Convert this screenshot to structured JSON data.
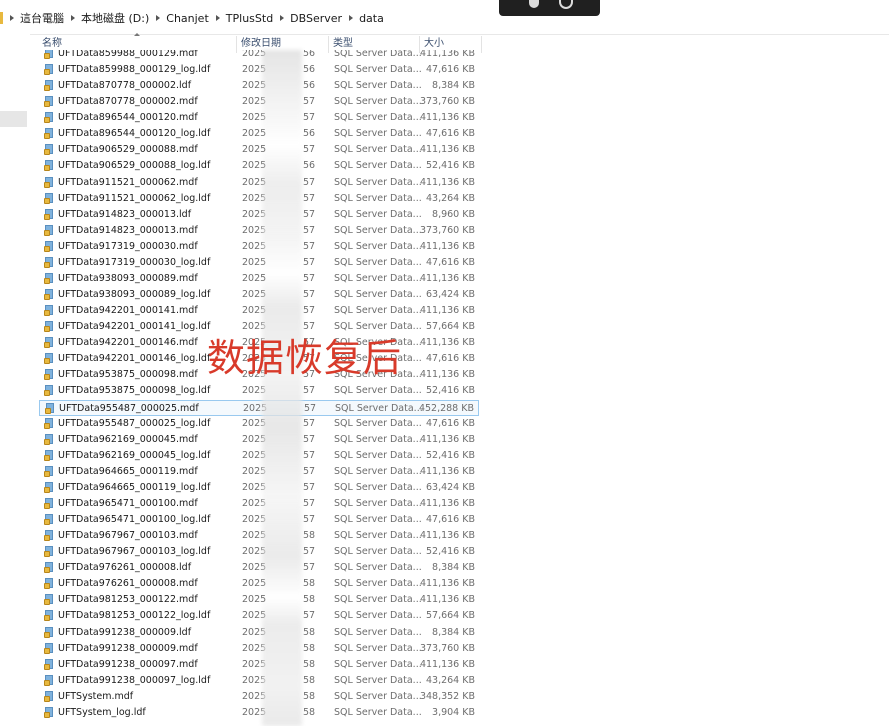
{
  "breadcrumb": [
    "這台電腦",
    "本地磁盘 (D:)",
    "Chanjet",
    "TPlusStd",
    "DBServer",
    "data"
  ],
  "columns": {
    "name": "名称",
    "date": "修改日期",
    "type": "类型",
    "size": "大小"
  },
  "watermark": "数据恢复后",
  "files": [
    {
      "name": "UFTData859988_000129.mdf",
      "date": "2025",
      "time": "56",
      "type": "SQL Server Data...",
      "size": "411,136 KB"
    },
    {
      "name": "UFTData859988_000129_log.ldf",
      "date": "2025",
      "time": "56",
      "type": "SQL Server Data...",
      "size": "47,616 KB"
    },
    {
      "name": "UFTData870778_000002.ldf",
      "date": "2025",
      "time": "56",
      "type": "SQL Server Data...",
      "size": "8,384 KB"
    },
    {
      "name": "UFTData870778_000002.mdf",
      "date": "2025",
      "time": "57",
      "type": "SQL Server Data...",
      "size": "373,760 KB"
    },
    {
      "name": "UFTData896544_000120.mdf",
      "date": "2025",
      "time": "57",
      "type": "SQL Server Data...",
      "size": "411,136 KB"
    },
    {
      "name": "UFTData896544_000120_log.ldf",
      "date": "2025",
      "time": "56",
      "type": "SQL Server Data...",
      "size": "47,616 KB"
    },
    {
      "name": "UFTData906529_000088.mdf",
      "date": "2025",
      "time": "57",
      "type": "SQL Server Data...",
      "size": "411,136 KB"
    },
    {
      "name": "UFTData906529_000088_log.ldf",
      "date": "2025",
      "time": "56",
      "type": "SQL Server Data...",
      "size": "52,416 KB"
    },
    {
      "name": "UFTData911521_000062.mdf",
      "date": "2025",
      "time": "57",
      "type": "SQL Server Data...",
      "size": "411,136 KB"
    },
    {
      "name": "UFTData911521_000062_log.ldf",
      "date": "2025",
      "time": "57",
      "type": "SQL Server Data...",
      "size": "43,264 KB"
    },
    {
      "name": "UFTData914823_000013.ldf",
      "date": "2025",
      "time": "57",
      "type": "SQL Server Data...",
      "size": "8,960 KB"
    },
    {
      "name": "UFTData914823_000013.mdf",
      "date": "2025",
      "time": "57",
      "type": "SQL Server Data...",
      "size": "373,760 KB"
    },
    {
      "name": "UFTData917319_000030.mdf",
      "date": "2025",
      "time": "57",
      "type": "SQL Server Data...",
      "size": "411,136 KB"
    },
    {
      "name": "UFTData917319_000030_log.ldf",
      "date": "2025",
      "time": "57",
      "type": "SQL Server Data...",
      "size": "47,616 KB"
    },
    {
      "name": "UFTData938093_000089.mdf",
      "date": "2025",
      "time": "57",
      "type": "SQL Server Data...",
      "size": "411,136 KB"
    },
    {
      "name": "UFTData938093_000089_log.ldf",
      "date": "2025",
      "time": "57",
      "type": "SQL Server Data...",
      "size": "63,424 KB"
    },
    {
      "name": "UFTData942201_000141.mdf",
      "date": "2025",
      "time": "57",
      "type": "SQL Server Data...",
      "size": "411,136 KB"
    },
    {
      "name": "UFTData942201_000141_log.ldf",
      "date": "2025",
      "time": "57",
      "type": "SQL Server Data...",
      "size": "57,664 KB"
    },
    {
      "name": "UFTData942201_000146.mdf",
      "date": "2025",
      "time": "57",
      "type": "SQL Server Data...",
      "size": "411,136 KB"
    },
    {
      "name": "UFTData942201_000146_log.ldf",
      "date": "2025",
      "time": "57",
      "type": "SQL Server Data...",
      "size": "47,616 KB"
    },
    {
      "name": "UFTData953875_000098.mdf",
      "date": "2025",
      "time": "57",
      "type": "SQL Server Data...",
      "size": "411,136 KB"
    },
    {
      "name": "UFTData953875_000098_log.ldf",
      "date": "2025",
      "time": "57",
      "type": "SQL Server Data...",
      "size": "52,416 KB"
    },
    {
      "name": "UFTData955487_000025.mdf",
      "date": "2025",
      "time": "57",
      "type": "SQL Server Data...",
      "size": "452,288 KB",
      "selected": true
    },
    {
      "name": "UFTData955487_000025_log.ldf",
      "date": "2025",
      "time": "57",
      "type": "SQL Server Data...",
      "size": "47,616 KB"
    },
    {
      "name": "UFTData962169_000045.mdf",
      "date": "2025",
      "time": "57",
      "type": "SQL Server Data...",
      "size": "411,136 KB"
    },
    {
      "name": "UFTData962169_000045_log.ldf",
      "date": "2025",
      "time": "57",
      "type": "SQL Server Data...",
      "size": "52,416 KB"
    },
    {
      "name": "UFTData964665_000119.mdf",
      "date": "2025",
      "time": "57",
      "type": "SQL Server Data...",
      "size": "411,136 KB"
    },
    {
      "name": "UFTData964665_000119_log.ldf",
      "date": "2025",
      "time": "57",
      "type": "SQL Server Data...",
      "size": "63,424 KB"
    },
    {
      "name": "UFTData965471_000100.mdf",
      "date": "2025",
      "time": "57",
      "type": "SQL Server Data...",
      "size": "411,136 KB"
    },
    {
      "name": "UFTData965471_000100_log.ldf",
      "date": "2025",
      "time": "57",
      "type": "SQL Server Data...",
      "size": "47,616 KB"
    },
    {
      "name": "UFTData967967_000103.mdf",
      "date": "2025",
      "time": "58",
      "type": "SQL Server Data...",
      "size": "411,136 KB"
    },
    {
      "name": "UFTData967967_000103_log.ldf",
      "date": "2025",
      "time": "57",
      "type": "SQL Server Data...",
      "size": "52,416 KB"
    },
    {
      "name": "UFTData976261_000008.ldf",
      "date": "2025",
      "time": "57",
      "type": "SQL Server Data...",
      "size": "8,384 KB"
    },
    {
      "name": "UFTData976261_000008.mdf",
      "date": "2025",
      "time": "58",
      "type": "SQL Server Data...",
      "size": "411,136 KB"
    },
    {
      "name": "UFTData981253_000122.mdf",
      "date": "2025",
      "time": "58",
      "type": "SQL Server Data...",
      "size": "411,136 KB"
    },
    {
      "name": "UFTData981253_000122_log.ldf",
      "date": "2025",
      "time": "57",
      "type": "SQL Server Data...",
      "size": "57,664 KB"
    },
    {
      "name": "UFTData991238_000009.ldf",
      "date": "2025",
      "time": "58",
      "type": "SQL Server Data...",
      "size": "8,384 KB"
    },
    {
      "name": "UFTData991238_000009.mdf",
      "date": "2025",
      "time": "58",
      "type": "SQL Server Data...",
      "size": "373,760 KB"
    },
    {
      "name": "UFTData991238_000097.mdf",
      "date": "2025",
      "time": "58",
      "type": "SQL Server Data...",
      "size": "411,136 KB"
    },
    {
      "name": "UFTData991238_000097_log.ldf",
      "date": "2025",
      "time": "58",
      "type": "SQL Server Data...",
      "size": "43,264 KB"
    },
    {
      "name": "UFTSystem.mdf",
      "date": "2025",
      "time": "58",
      "type": "SQL Server Data...",
      "size": "348,352 KB"
    },
    {
      "name": "UFTSystem_log.ldf",
      "date": "2025",
      "time": "58",
      "type": "SQL Server Data...",
      "size": "3,904 KB"
    }
  ]
}
